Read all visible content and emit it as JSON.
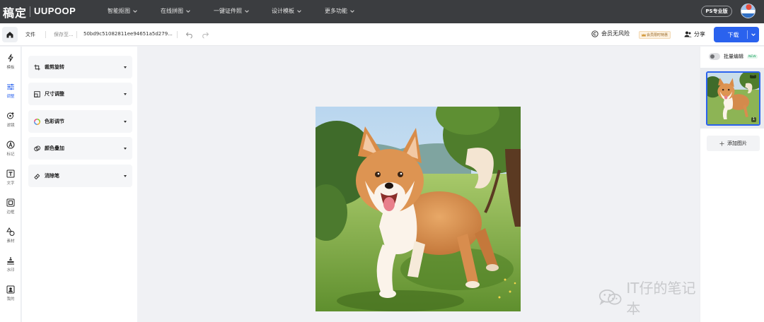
{
  "brand": {
    "name_cn": "稿定",
    "name_en": "UUPOOP"
  },
  "nav": [
    {
      "label": "智能抠图"
    },
    {
      "label": "在线拼图"
    },
    {
      "label": "一键证件照"
    },
    {
      "label": "设计模板"
    },
    {
      "label": "更多功能"
    }
  ],
  "header_right": {
    "ps_label": "PS专业版"
  },
  "toolbar": {
    "file_label": "文件",
    "save_label": "保存至...",
    "filename": "50bd9c51082811ee94651a5d279...",
    "risk_label": "会员无风险",
    "vip_badge": "会员限时特惠",
    "share_label": "分享",
    "download_label": "下载"
  },
  "rail": [
    {
      "label": "模板",
      "icon": "template-icon"
    },
    {
      "label": "调整",
      "icon": "adjust-icon",
      "active": true
    },
    {
      "label": "滤镜",
      "icon": "filter-icon"
    },
    {
      "label": "标记",
      "icon": "mark-icon"
    },
    {
      "label": "文字",
      "icon": "text-icon"
    },
    {
      "label": "边框",
      "icon": "border-icon"
    },
    {
      "label": "素材",
      "icon": "material-icon"
    },
    {
      "label": "水印",
      "icon": "watermark-icon"
    },
    {
      "label": "我的",
      "icon": "mine-icon"
    }
  ],
  "tools": [
    {
      "label": "裁剪旋转",
      "icon": "crop-icon"
    },
    {
      "label": "尺寸调整",
      "icon": "resize-icon"
    },
    {
      "label": "色彩调节",
      "icon": "color-icon"
    },
    {
      "label": "颜色叠加",
      "icon": "overlay-icon"
    },
    {
      "label": "消除笔",
      "icon": "eraser-icon"
    }
  ],
  "right_panel": {
    "batch_label": "批量编辑",
    "new_tag": "NEW",
    "thumb_index": "1",
    "add_image_label": "添加图片"
  },
  "canvas": {
    "watermark_text": "IT仔的笔记本"
  },
  "colors": {
    "accent": "#2a62ee",
    "topbar": "#3b3d40"
  }
}
